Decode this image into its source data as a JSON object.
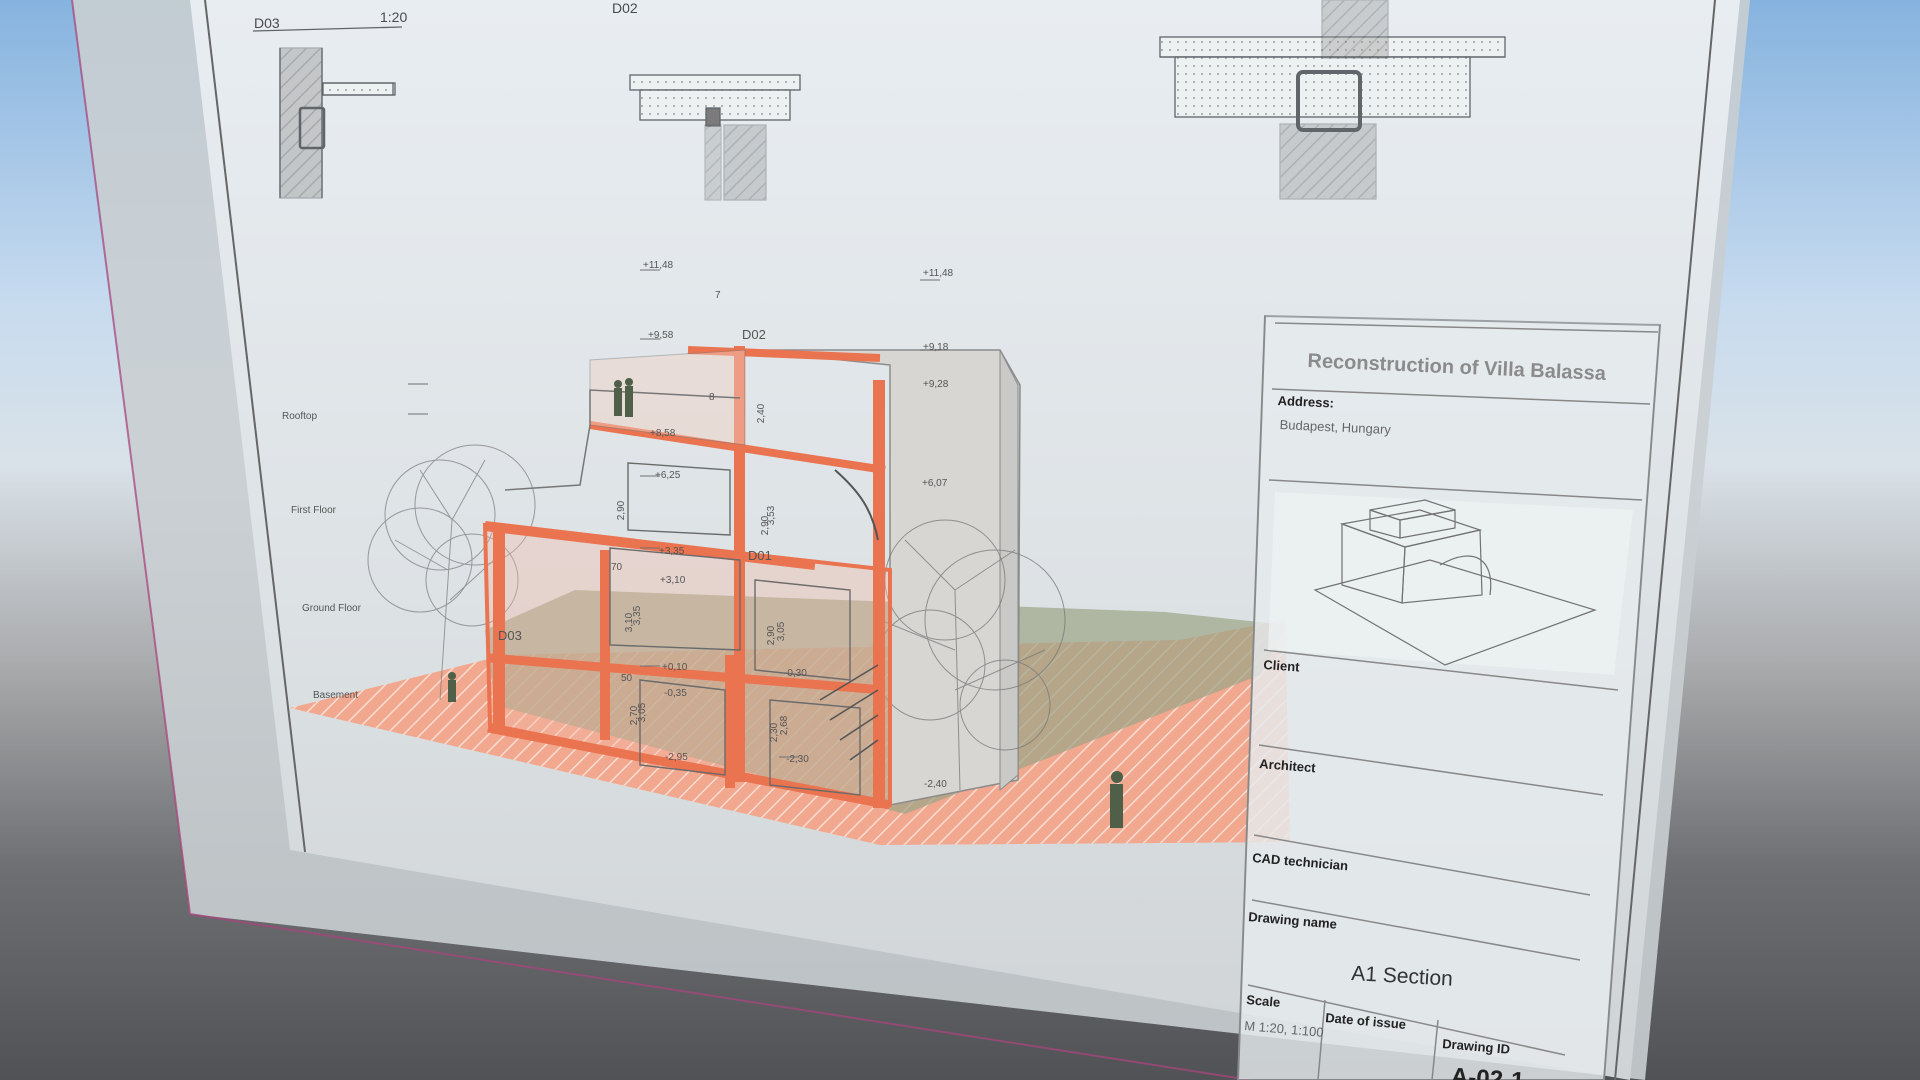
{
  "title_block": {
    "project_title": "Reconstruction of Villa Balassa",
    "address_label": "Address:",
    "address_value": "Budapest, Hungary",
    "client_label": "Client",
    "architect_label": "Architect",
    "cad_label": "CAD technician",
    "drawing_name_label": "Drawing name",
    "drawing_name_value": "A1 Section",
    "scale_label": "Scale",
    "scale_value": "M 1:20, 1:100",
    "date_label": "Date of issue",
    "drawing_id_label": "Drawing ID",
    "drawing_id_value": "A-02-1"
  },
  "details": {
    "d03_label": "D03",
    "d03_scale": "1:20",
    "d02_label": "D02"
  },
  "levels": {
    "roof_top": "+11,48",
    "roof_top_2": "+11,48",
    "roof": "+9,58",
    "roof_2": "+9,18",
    "roof_3": "+9,28",
    "roof_4": "+8,58",
    "level_1": "+6,25",
    "level_2": "+6,07",
    "level_3": "+3,35",
    "level_4": "+3,10",
    "level_5": "+0,10",
    "level_6": "-0,35",
    "level_7": "-0,30",
    "level_8": "-2,95",
    "level_9": "-2,30",
    "level_10": "-2,40"
  },
  "floors": {
    "roof": "Rooftop",
    "first": "First Floor",
    "ground": "Ground Floor",
    "basement": "Basement"
  },
  "callouts": {
    "d01": "D01",
    "d02": "D02",
    "d03": "D03"
  },
  "dimensions": {
    "a": "2,40",
    "b": "2,90",
    "c": "3,53",
    "d": "2,90",
    "e": "3,10",
    "f": "3,35",
    "g": "2,90",
    "h": "3,05",
    "i": "2,70",
    "j": "3,05",
    "k": "2,30",
    "l": "2,68",
    "m": "70",
    "n": "50",
    "o": "8",
    "p": "7"
  },
  "colors": {
    "cut_orange": "#e9784f",
    "cut_fill": "#f5a88e",
    "grass": "#98a784",
    "paper": "#d9dee0",
    "line": "#6e6e6e"
  }
}
